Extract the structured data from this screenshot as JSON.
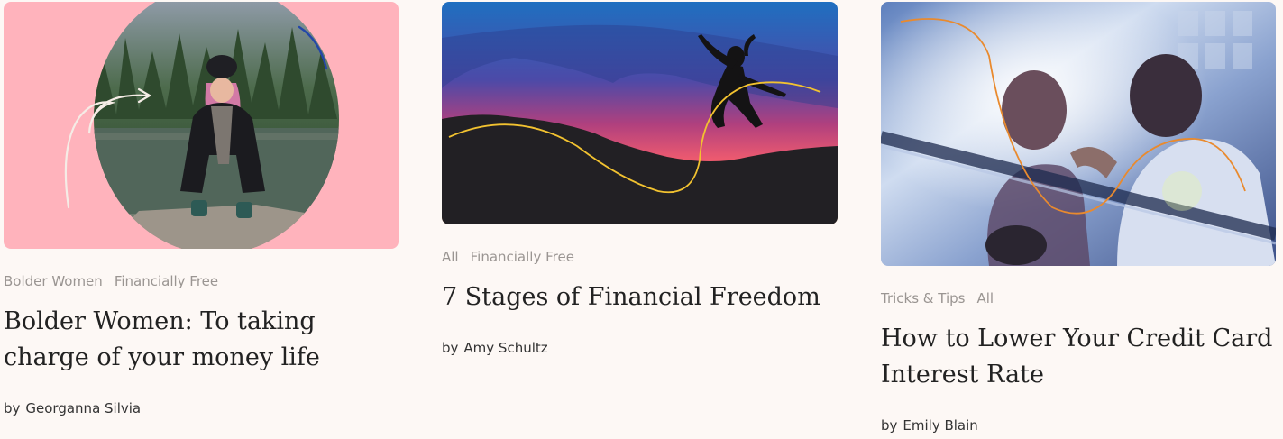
{
  "articles": [
    {
      "image_alt": "Woman with pink hair crouching by a lake",
      "tags": [
        "Bolder Women",
        "Financially Free"
      ],
      "title": "Bolder Women: To taking charge of your money life",
      "by": "by",
      "author": "Georganna Silvia"
    },
    {
      "image_alt": "Silhouette of a person jumping at sunset",
      "tags": [
        "All",
        "Financially Free"
      ],
      "title": "7 Stages of Financial Freedom",
      "by": "by",
      "author": "Amy Schultz"
    },
    {
      "image_alt": "Boxing coach with athlete in a ring",
      "tags": [
        "Tricks & Tips",
        "All"
      ],
      "title": "How to Lower Your Credit Card Interest Rate",
      "by": "by",
      "author": "Emily Blain"
    }
  ],
  "colors": {
    "background": "#fdf8f5",
    "card1_bg": "#ffb3bc",
    "accent_yellow": "#f2c230",
    "accent_orange": "#e98a2e",
    "tag_text": "#9a9592"
  }
}
